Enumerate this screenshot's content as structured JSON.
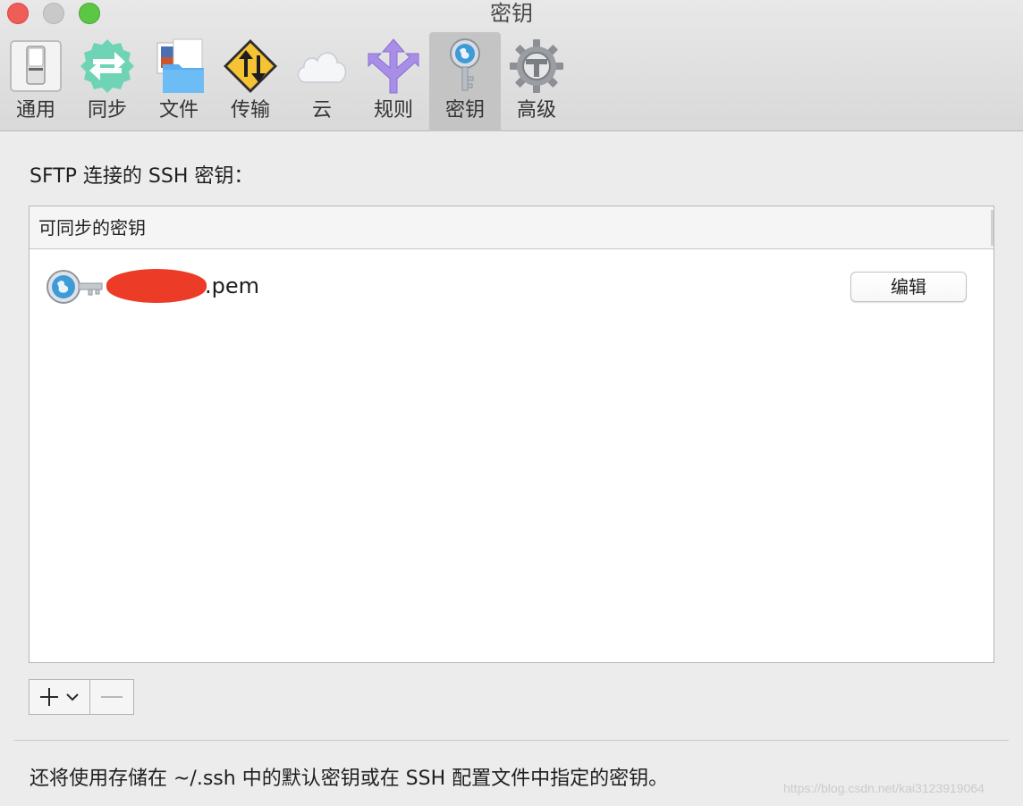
{
  "window": {
    "title": "密钥"
  },
  "toolbar": {
    "items": [
      {
        "label": "通用",
        "icon": "switch-icon"
      },
      {
        "label": "同步",
        "icon": "sync-icon"
      },
      {
        "label": "文件",
        "icon": "folder-icon"
      },
      {
        "label": "传输",
        "icon": "transfer-icon"
      },
      {
        "label": "云",
        "icon": "cloud-icon"
      },
      {
        "label": "规则",
        "icon": "rules-icon"
      },
      {
        "label": "密钥",
        "icon": "key-icon",
        "selected": true
      },
      {
        "label": "高级",
        "icon": "gear-icon"
      }
    ]
  },
  "section": {
    "title": "SFTP 连接的 SSH 密钥："
  },
  "key_list": {
    "header": "可同步的密钥",
    "rows": [
      {
        "name_suffix": ".pem",
        "edit_label": "编辑"
      }
    ]
  },
  "controls": {
    "add_symbol": "+",
    "remove_symbol": "—"
  },
  "footer": {
    "note": "还将使用存储在 ~/.ssh 中的默认密钥或在 SSH 配置文件中指定的密钥。"
  },
  "watermark": "https://blog.csdn.net/kai3123919064",
  "colors": {
    "redaction": "#ec3b26",
    "selected_tab": "#c4c4c4"
  }
}
